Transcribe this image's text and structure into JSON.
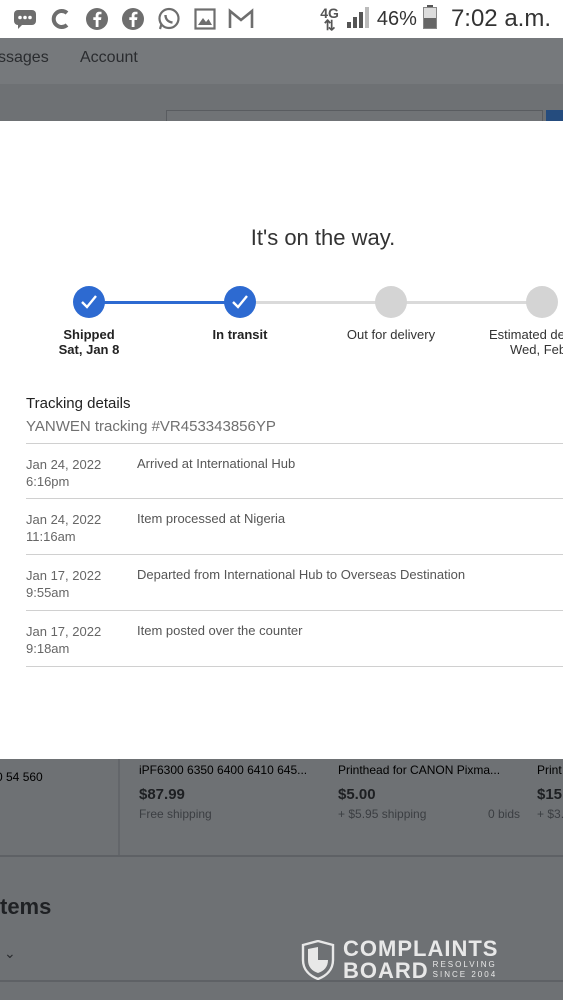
{
  "status_bar": {
    "network": "4G",
    "battery": "46%",
    "time": "7:02 a.m."
  },
  "background_page": {
    "nav": [
      "ssages",
      "Account"
    ],
    "cards": [
      {
        "title_fragment": "0 54 560"
      },
      {
        "title": "iPF6300 6350 6400 6410 645...",
        "price": "$87.99",
        "shipping": "Free shipping"
      },
      {
        "title": "Printhead for CANON Pixma...",
        "price": "$5.00",
        "shipping": "+ $5.95 shipping",
        "bids": "0 bids"
      },
      {
        "title": "Print",
        "price": "$15",
        "shipping": "+ $3."
      }
    ],
    "section_heading": "tems"
  },
  "tracking_modal": {
    "headline": "It's on the way.",
    "steps": [
      {
        "label": "Shipped",
        "sublabel": "Sat, Jan 8",
        "status": "done"
      },
      {
        "label": "In transit",
        "sublabel": "",
        "status": "done"
      },
      {
        "label": "Out for delivery",
        "sublabel": "",
        "status": "pending"
      },
      {
        "label": "Estimated de",
        "sublabel": "Wed, Feb",
        "status": "pending"
      }
    ],
    "details_title": "Tracking details",
    "carrier_line": "YANWEN tracking #VR453343856YP",
    "events": [
      {
        "date": "Jan 24, 2022",
        "time": "6:16pm",
        "description": "Arrived at International Hub"
      },
      {
        "date": "Jan 24, 2022",
        "time": "11:16am",
        "description": "Item processed at Nigeria"
      },
      {
        "date": "Jan 17, 2022",
        "time": "9:55am",
        "description": "Departed from International Hub to Overseas Destination"
      },
      {
        "date": "Jan 17, 2022",
        "time": "9:18am",
        "description": "Item posted over the counter"
      }
    ]
  },
  "watermark": {
    "line1": "COMPLAINTS",
    "line2": "BOARD",
    "sub1": "RESOLVING",
    "sub2": "SINCE 2004"
  },
  "colors": {
    "accent": "#2d6ad1",
    "pending": "#d4d4d4",
    "overlay": "#6e7174"
  }
}
